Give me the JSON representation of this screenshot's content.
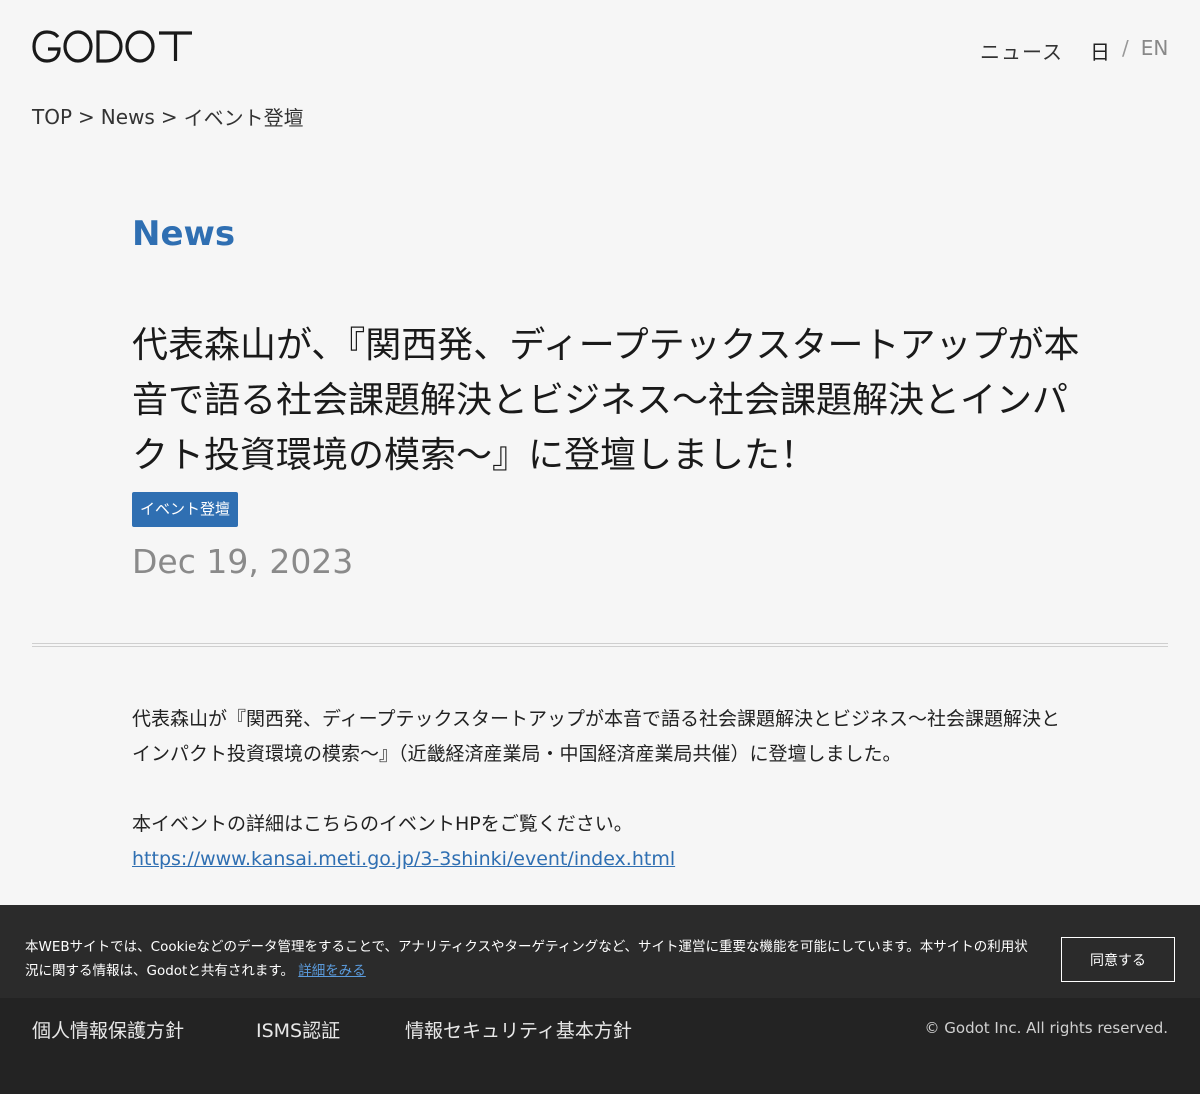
{
  "header": {
    "logo_text": "GODOT",
    "nav_news": "ニュース",
    "lang_ja": "日",
    "lang_sep": "/",
    "lang_en": "EN"
  },
  "breadcrumb": {
    "items": [
      "TOP",
      "News",
      "イベント登壇"
    ],
    "separator": ">"
  },
  "article": {
    "section_label": "News",
    "title": "代表森山が、『関西発、ディープテックスタートアップが本音で語る社会課題解決とビジネス〜社会課題解決とインパクト投資環境の模索〜』に登壇しました！",
    "tag": "イベント登壇",
    "date": "Dec 19, 2023",
    "paragraph1": "代表森山が『関西発、ディープテックスタートアップが本音で語る社会課題解決とビジネス〜社会課題解決とインパクト投資環境の模索〜』（近畿経済産業局・中国経済産業局共催）に登壇しました。",
    "paragraph2": "本イベントの詳細はこちらのイベントHPをご覧ください。",
    "link": "https://www.kansai.meti.go.jp/3-3shinki/event/index.html"
  },
  "cookie_banner": {
    "text": "本WEBサイトでは、Cookieなどのデータ管理をすることで、アナリティクスやターゲティングなど、サイト運営に重要な機能を可能にしています。本サイトの利用状況に関する情報は、Godotと共有されます。",
    "more_link": "詳細をみる",
    "accept_button": "同意する"
  },
  "footer": {
    "links": [
      "個人情報保護方針",
      "ISMS認証",
      "情報セキュリティ基本方針"
    ],
    "copyright": "© Godot Inc. All rights reserved."
  },
  "colors": {
    "accent": "#2f6fb2",
    "background": "#f6f6f6",
    "cookie_bg": "#2b2b2b",
    "footer_bg": "#232323"
  }
}
